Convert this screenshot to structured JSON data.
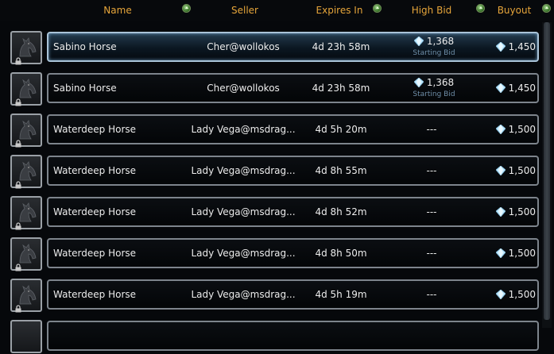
{
  "headers": {
    "name": "Name",
    "seller": "Seller",
    "expires": "Expires In",
    "high_bid": "High Bid",
    "buyout": "Buyout"
  },
  "colors": {
    "header_text": "#e6a53a",
    "subtext": "#6f8ea8",
    "selected_border": "#a9c3d8"
  },
  "icons": {
    "sort": "sort-ascending-icon",
    "currency": "astral-diamond-icon",
    "item": "horse-icon",
    "bound": "lock-icon"
  },
  "rows": [
    {
      "name": "Sabino Horse",
      "seller": "Cher@wollokos",
      "expires": "4d 23h 58m",
      "bid": "1,368",
      "bid_note": "Starting Bid",
      "buyout": "1,450",
      "selected": true
    },
    {
      "name": "Sabino Horse",
      "seller": "Cher@wollokos",
      "expires": "4d 23h 58m",
      "bid": "1,368",
      "bid_note": "Starting Bid",
      "buyout": "1,450",
      "selected": false
    },
    {
      "name": "Waterdeep Horse",
      "seller": "Lady Vega@msdrag...",
      "expires": "4d 5h 20m",
      "bid": "---",
      "bid_note": "",
      "buyout": "1,500",
      "selected": false
    },
    {
      "name": "Waterdeep Horse",
      "seller": "Lady Vega@msdrag...",
      "expires": "4d 8h 55m",
      "bid": "---",
      "bid_note": "",
      "buyout": "1,500",
      "selected": false
    },
    {
      "name": "Waterdeep Horse",
      "seller": "Lady Vega@msdrag...",
      "expires": "4d 8h 52m",
      "bid": "---",
      "bid_note": "",
      "buyout": "1,500",
      "selected": false
    },
    {
      "name": "Waterdeep Horse",
      "seller": "Lady Vega@msdrag...",
      "expires": "4d 8h 50m",
      "bid": "---",
      "bid_note": "",
      "buyout": "1,500",
      "selected": false
    },
    {
      "name": "Waterdeep Horse",
      "seller": "Lady Vega@msdrag...",
      "expires": "4d 5h 19m",
      "bid": "---",
      "bid_note": "",
      "buyout": "1,500",
      "selected": false
    }
  ]
}
